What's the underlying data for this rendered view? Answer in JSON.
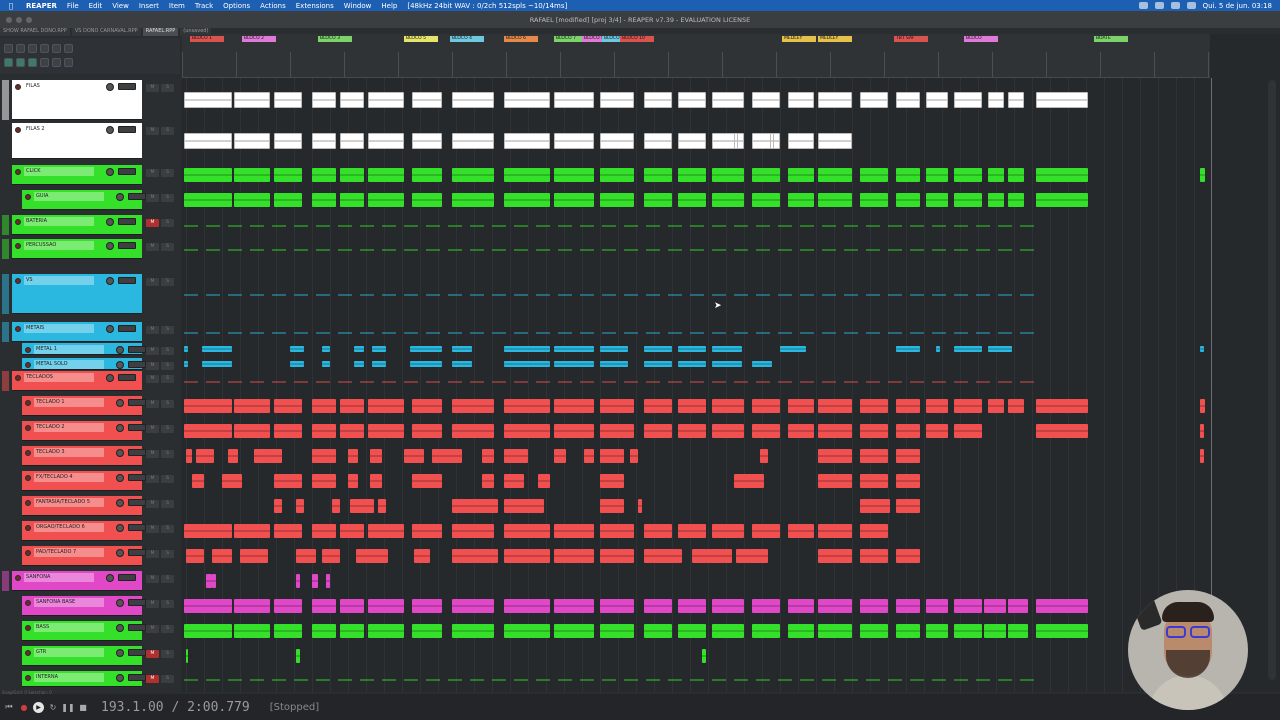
{
  "menubar": {
    "items": [
      "REAPER",
      "File",
      "Edit",
      "View",
      "Insert",
      "Item",
      "Track",
      "Options",
      "Actions",
      "Extensions",
      "Window",
      "Help"
    ],
    "audio_info": "[48kHz 24bit WAV : 0/2ch 512spls ~10/14ms]",
    "clock": "Qui. 5 de jun. 03:18"
  },
  "title": "RAFAEL [modified] [proj 3/4] - REAPER v7.39 - EVALUATION LICENSE",
  "tabs": [
    "SHOW RAFAEL DONO.RPP",
    "VS DONO CARNAVAL.RPP",
    "RAFAEL.RPP",
    "(unsaved)"
  ],
  "regions": [
    {
      "label": "BLOCO 1",
      "color": "#d9534f"
    },
    {
      "label": "BLOCO 2",
      "color": "#e07ad8"
    },
    {
      "label": "BLOCO 3",
      "color": "#7bd36a"
    },
    {
      "label": "BLOCO 4",
      "color": "#6ec8e0"
    },
    {
      "label": "BLOCO 5",
      "color": "#e5e56b"
    },
    {
      "label": "BLOCO 6",
      "color": "#e58a4a"
    },
    {
      "label": "BLOCO 7",
      "color": "#7bd36a"
    },
    {
      "label": "BLOCO 8",
      "color": "#e07ad8"
    },
    {
      "label": "BLOCO 9",
      "color": "#6ec8e0"
    },
    {
      "label": "BLOCO 10",
      "color": "#d9534f"
    },
    {
      "label": "MEDLEY",
      "color": "#e5c04b"
    },
    {
      "label": "MEDLEY",
      "color": "#e5c04b"
    },
    {
      "label": "TBT SAF",
      "color": "#d9534f"
    },
    {
      "label": "BLOCO",
      "color": "#e07ad8"
    },
    {
      "label": "BOATE",
      "color": "#7bd36a"
    }
  ],
  "tracks": [
    {
      "name": "FILAS",
      "color": "#ffffff",
      "type": "folder"
    },
    {
      "name": "FILAS 2",
      "color": "#ffffff",
      "type": "track"
    },
    {
      "name": "CLICK",
      "color": "#35e02a",
      "type": "track"
    },
    {
      "name": "GUIA",
      "color": "#35e02a",
      "type": "track"
    },
    {
      "name": "BATERIA",
      "color": "#35e02a",
      "type": "folder"
    },
    {
      "name": "PERCUSSAO",
      "color": "#35e02a",
      "type": "folder"
    },
    {
      "name": "VS",
      "color": "#2ab8e0",
      "type": "folder"
    },
    {
      "name": "METAIS",
      "color": "#2ab8e0",
      "type": "folder"
    },
    {
      "name": "METAL 1",
      "color": "#2ab8e0",
      "type": "track"
    },
    {
      "name": "METAL SOLO",
      "color": "#2ab8e0",
      "type": "track"
    },
    {
      "name": "TECLADOS",
      "color": "#f05050",
      "type": "folder"
    },
    {
      "name": "TECLADO 1",
      "color": "#f05050",
      "type": "track"
    },
    {
      "name": "TECLADO 2",
      "color": "#f05050",
      "type": "track"
    },
    {
      "name": "TECLADO 3",
      "color": "#f05050",
      "type": "track"
    },
    {
      "name": "FX/TECLADO 4",
      "color": "#f05050",
      "type": "track"
    },
    {
      "name": "FANTASIA/TECLADO 5",
      "color": "#f05050",
      "type": "track"
    },
    {
      "name": "ORGAO/TECLADO 6",
      "color": "#f05050",
      "type": "track"
    },
    {
      "name": "PAD/TECLADO 7",
      "color": "#f05050",
      "type": "track"
    },
    {
      "name": "SANFONA",
      "color": "#e048c8",
      "type": "folder"
    },
    {
      "name": "SANFONA BASE",
      "color": "#e048c8",
      "type": "track"
    },
    {
      "name": "BASS",
      "color": "#35e02a",
      "type": "track"
    },
    {
      "name": "GTR",
      "color": "#35e02a",
      "type": "track"
    },
    {
      "name": "INTERNA",
      "color": "#35e02a",
      "type": "track"
    }
  ],
  "transport": {
    "position": "193.1.00 / 2:00.779",
    "state": "[Stopped]"
  },
  "status": "Snap/Grid: 0  Selection: 0"
}
